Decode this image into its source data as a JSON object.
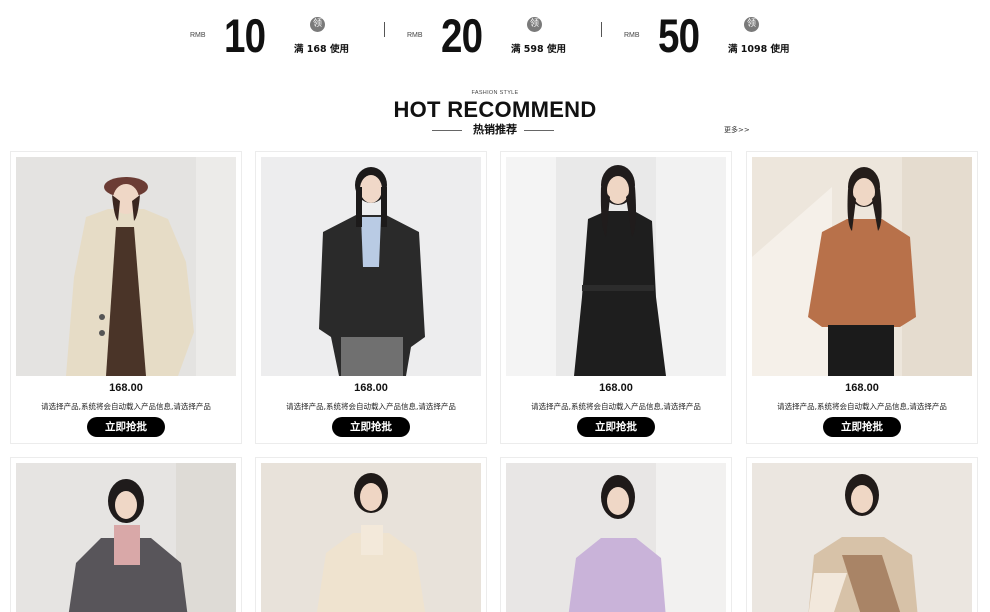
{
  "coupons": [
    {
      "currency": "RMB",
      "amount": "10",
      "badge": "领",
      "condition": "满 168 使用"
    },
    {
      "currency": "RMB",
      "amount": "20",
      "badge": "领",
      "condition": "满 598 使用"
    },
    {
      "currency": "RMB",
      "amount": "50",
      "badge": "领",
      "condition": "满 1098 使用"
    }
  ],
  "section": {
    "subtitle_en": "FASHION STYLE",
    "title": "HOT RECOMMEND",
    "subtitle_cn": "热销推荐",
    "more_link": "更多>>"
  },
  "products": [
    {
      "price": "168.00",
      "desc": "请选择产品,系统将会自动载入产品信息,请选择产品",
      "button": "立即抢批",
      "image": "woman-beige-coat-beret"
    },
    {
      "price": "168.00",
      "desc": "请选择产品,系统将会自动载入产品信息,请选择产品",
      "button": "立即抢批",
      "image": "woman-black-leather-jacket"
    },
    {
      "price": "168.00",
      "desc": "请选择产品,系统将会自动载入产品信息,请选择产品",
      "button": "立即抢批",
      "image": "woman-black-belted-coat"
    },
    {
      "price": "168.00",
      "desc": "请选择产品,系统将会自动载入产品信息,请选择产品",
      "button": "立即抢批",
      "image": "woman-rust-knit-sweater"
    }
  ],
  "products_row2": [
    {
      "image": "woman-grey-puffer-jacket"
    },
    {
      "image": "woman-cream-cardigan"
    },
    {
      "image": "woman-lilac-polo-sweater"
    },
    {
      "image": "woman-colorblock-sweater"
    }
  ],
  "colors": {
    "button_bg": "#000000",
    "button_text": "#ffffff",
    "badge_bg": "#7a7a7a",
    "card_border": "#ececec"
  }
}
